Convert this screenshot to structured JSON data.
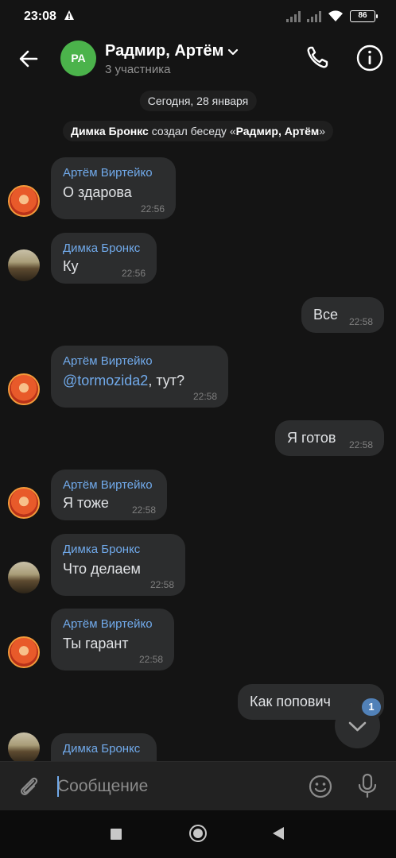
{
  "status_bar": {
    "time": "23:08",
    "battery": "86",
    "icons": [
      "alert-icon",
      "signal-icon",
      "signal-icon",
      "wifi-icon",
      "battery-icon"
    ]
  },
  "header": {
    "avatar_initials": "РА",
    "title": "Радмир, Артём",
    "subtitle": "3 участника",
    "colors": {
      "avatar": "#4bb34b"
    }
  },
  "chat": {
    "date_pill": "Сегодня, 28 января",
    "system_message": {
      "actor": "Димка Бронкс",
      "action": "создал беседу «",
      "chat_name": "Радмир, Артём",
      "close": "»"
    },
    "messages": [
      {
        "author": "Артём Виртейко",
        "text": "О здарова",
        "time": "22:56"
      },
      {
        "author": "Димка Бронкс",
        "text": "Ку",
        "time": "22:56"
      },
      {
        "text": "Все",
        "time": "22:58"
      },
      {
        "author": "Артём Виртейко",
        "mention": "@tormozida2",
        "text": ", тут?",
        "time": "22:58"
      },
      {
        "text": "Я готов",
        "time": "22:58"
      },
      {
        "author": "Артём Виртейко",
        "text": "Я тоже",
        "time": "22:58"
      },
      {
        "author": "Димка Бронкс",
        "text": "Что делаем",
        "time": "22:58"
      },
      {
        "author": "Артём Виртейко",
        "text": "Ты гарант",
        "time": "22:58"
      },
      {
        "text": "Как попович"
      },
      {
        "author": "Димка Бронкс"
      }
    ],
    "scroll_badge": "1"
  },
  "composer": {
    "placeholder": "Сообщение"
  },
  "colors": {
    "background": "#141414",
    "bubble": "#2c2d2e",
    "accent": "#71aaeb",
    "badge": "#5181b8"
  }
}
